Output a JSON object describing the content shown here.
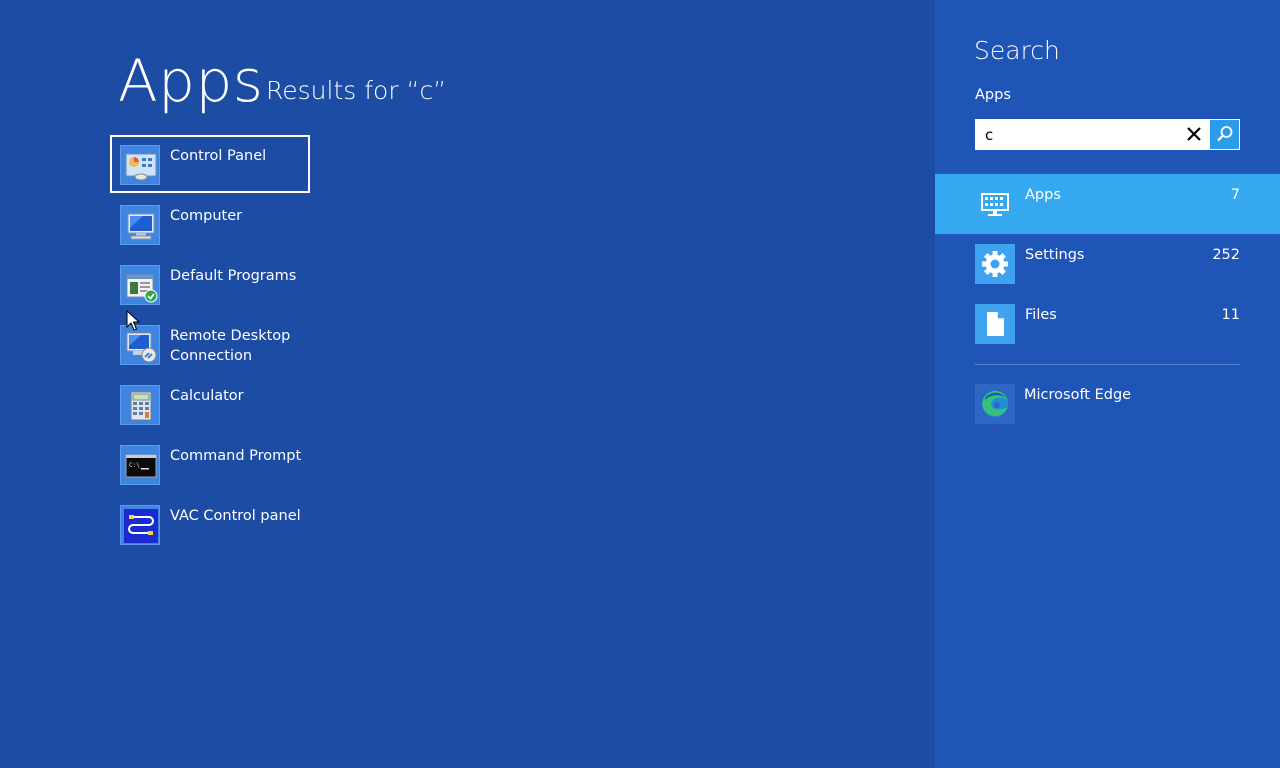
{
  "results": {
    "title": "Apps",
    "subtitle": "Results for “c”",
    "apps": [
      {
        "label": "Control Panel",
        "icon": "control-panel-icon",
        "selected": true
      },
      {
        "label": "Computer",
        "icon": "computer-icon"
      },
      {
        "label": "Default Programs",
        "icon": "default-programs-icon"
      },
      {
        "label": "Remote Desktop Connection",
        "icon": "remote-desktop-icon"
      },
      {
        "label": "Calculator",
        "icon": "calculator-icon"
      },
      {
        "label": "Command Prompt",
        "icon": "command-prompt-icon"
      },
      {
        "label": "VAC Control panel",
        "icon": "vac-control-panel-icon"
      }
    ]
  },
  "search_pane": {
    "title": "Search",
    "scope_label": "Apps",
    "query": "c",
    "categories": [
      {
        "label": "Apps",
        "count": "7",
        "icon": "apps-icon",
        "active": true
      },
      {
        "label": "Settings",
        "count": "252",
        "icon": "gear-icon"
      },
      {
        "label": "Files",
        "count": "11",
        "icon": "file-icon"
      }
    ],
    "suggestion": {
      "label": "Microsoft Edge",
      "icon": "microsoft-edge-icon"
    }
  },
  "colors": {
    "background": "#1c4ca3",
    "pane": "#1f55b6",
    "active_row": "#35a8f0",
    "tile": "#3ea2ee",
    "search_button": "#2c9ce9"
  }
}
